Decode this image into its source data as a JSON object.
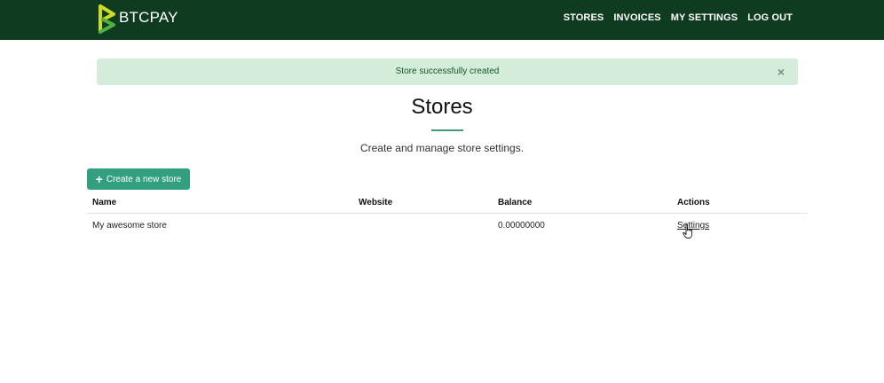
{
  "brand": {
    "name": "BTCPAY",
    "colors": {
      "logo_primary": "#cedc21",
      "logo_secondary": "#51b13e",
      "navbar": "#0f3b21"
    }
  },
  "nav": {
    "items": [
      {
        "label": "STORES"
      },
      {
        "label": "INVOICES"
      },
      {
        "label": "MY SETTINGS"
      },
      {
        "label": "LOG OUT"
      }
    ]
  },
  "alert": {
    "message": "Store successfully created",
    "close_symbol": "×",
    "color": "#d4edda"
  },
  "page": {
    "title": "Stores",
    "subtitle": "Create and manage store settings.",
    "accent": "#329f80"
  },
  "actions": {
    "create_icon": "+",
    "create_label": "Create a new store"
  },
  "table": {
    "columns": [
      "Name",
      "Website",
      "Balance",
      "Actions"
    ],
    "rows": [
      {
        "name": "My awesome store",
        "website": "",
        "balance": "0.00000000",
        "action": "Settings"
      }
    ]
  },
  "icons": {
    "logo": "btcpay-logo-icon",
    "close": "close-icon",
    "plus": "plus-icon",
    "cursor": "hand-pointer-icon"
  }
}
